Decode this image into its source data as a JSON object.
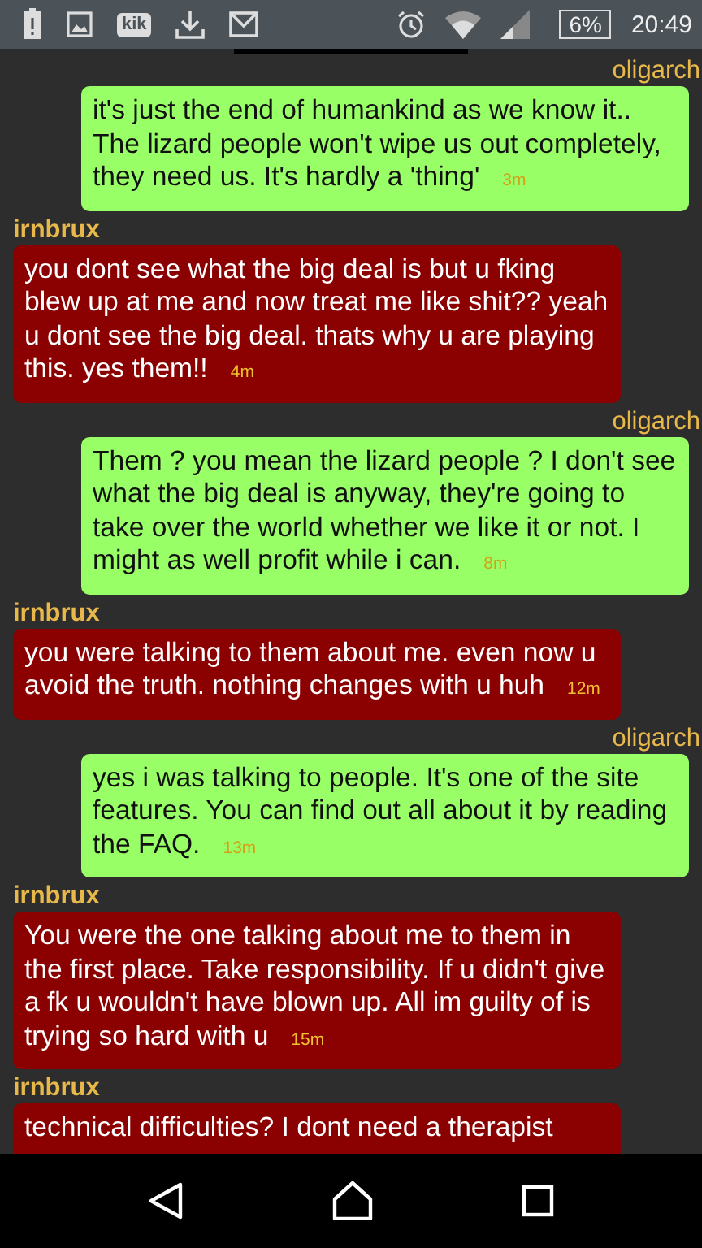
{
  "status_bar": {
    "notifications": [
      {
        "kind": "battery-alert"
      },
      {
        "kind": "image"
      },
      {
        "kind": "kik",
        "label": "kik"
      },
      {
        "kind": "download"
      },
      {
        "kind": "mail"
      }
    ],
    "battery": "6%",
    "time": "20:49"
  },
  "messages": [
    {
      "kind": "sent",
      "sender": "oligarch",
      "text": "it's just the end of humankind as we know it.. The lizard people won't wipe us out completely, they need us. It's hardly a 'thing'",
      "time": "3m"
    },
    {
      "kind": "received",
      "sender": "irnbrux",
      "text": "you dont see what the big deal is but u fking blew up at me and now treat me like shit?? yeah u dont see the big deal. thats why u are playing this. yes them!!",
      "time": "4m"
    },
    {
      "kind": "sent",
      "sender": "oligarch",
      "text": "Them ? you mean the lizard people ? I don't see what the big deal is anyway, they're going to take over the world whether we like it or not. I might as well profit while i can.",
      "time": "8m"
    },
    {
      "kind": "received",
      "sender": "irnbrux",
      "text": "you were talking to them about me. even now u avoid the truth. nothing changes with u huh",
      "time": "12m"
    },
    {
      "kind": "sent",
      "sender": "oligarch",
      "text": "yes i was talking to people. It's one of the site features. You can find out all about it by reading the FAQ.",
      "time": "13m"
    },
    {
      "kind": "received",
      "sender": "irnbrux",
      "text": "You were the one talking about me to them in the first place. Take responsibility. If u didn't give a fk u wouldn't have blown up. All im guilty of is trying so hard with u",
      "time": "15m"
    },
    {
      "kind": "received",
      "sender": "irnbrux",
      "text": "technical difficulties? I dont need a therapist"
    }
  ]
}
